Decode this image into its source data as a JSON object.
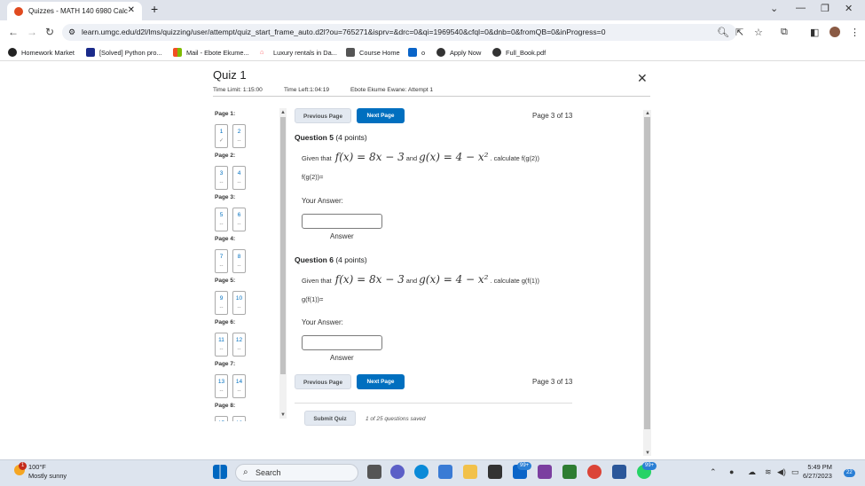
{
  "browser": {
    "tab_title": "Quizzes - MATH 140 6980 Calc",
    "new_tab": "+",
    "url": "learn.umgc.edu/d2l/lms/quizzing/user/attempt/quiz_start_frame_auto.d2l?ou=765271&isprv=&drc=0&qi=1969540&cfql=0&dnb=0&fromQB=0&inProgress=0",
    "bookmarks": [
      "Homework Market",
      "[Solved] Python pro...",
      "Mail - Ebote Ekume...",
      "Luxury rentals in Da...",
      "Course Home",
      "o",
      "Apply Now",
      "Full_Book.pdf"
    ]
  },
  "quiz": {
    "title": "Quiz 1",
    "time_limit": "Time Limit: 1:15:00",
    "time_left": "Time Left:1:04:19",
    "attempt": "Ebote Ekume Ewane: Attempt 1",
    "previous_page": "Previous Page",
    "next_page": "Next Page",
    "page_indicator": "Page 3 of 13",
    "submit": "Submit Quiz",
    "saved_status": "1 of 25 questions saved"
  },
  "sidebar": {
    "pages": [
      {
        "label": "Page 1:",
        "q": [
          {
            "n": "1",
            "s": "✓"
          },
          {
            "n": "2",
            "s": "--"
          }
        ]
      },
      {
        "label": "Page 2:",
        "q": [
          {
            "n": "3",
            "s": "--"
          },
          {
            "n": "4",
            "s": "--"
          }
        ]
      },
      {
        "label": "Page 3:",
        "q": [
          {
            "n": "5",
            "s": "--"
          },
          {
            "n": "6",
            "s": "--"
          }
        ]
      },
      {
        "label": "Page 4:",
        "q": [
          {
            "n": "7",
            "s": "--"
          },
          {
            "n": "8",
            "s": "--"
          }
        ]
      },
      {
        "label": "Page 5:",
        "q": [
          {
            "n": "9",
            "s": "--"
          },
          {
            "n": "10",
            "s": "--"
          }
        ]
      },
      {
        "label": "Page 6:",
        "q": [
          {
            "n": "11",
            "s": "--"
          },
          {
            "n": "12",
            "s": "--"
          }
        ]
      },
      {
        "label": "Page 7:",
        "q": [
          {
            "n": "13",
            "s": "--"
          },
          {
            "n": "14",
            "s": "--"
          }
        ]
      },
      {
        "label": "Page 8:",
        "q": [
          {
            "n": "15",
            "s": "--"
          },
          {
            "n": "16",
            "s": "--"
          }
        ]
      }
    ]
  },
  "questions": [
    {
      "title": "Question 5",
      "points": "(4 points)",
      "given": "Given that",
      "f": "f(x) = 8x − 3",
      "and": "and",
      "g": "g(x) = 4 − x²",
      "calc": ". calculate f(g(2))",
      "expr": "f(g(2))=",
      "your_answer": "Your Answer:",
      "answer_label": "Answer",
      "value": ""
    },
    {
      "title": "Question 6",
      "points": "(4 points)",
      "given": "Given that",
      "f": "f(x) = 8x − 3",
      "and": "and",
      "g": "g(x) = 4 − x²",
      "calc": ". calculate g(f(1))",
      "expr": "g(f(1))=",
      "your_answer": "Your Answer:",
      "answer_label": "Answer",
      "value": ""
    }
  ],
  "taskbar": {
    "weather_temp": "100°F",
    "weather_desc": "Mostly sunny",
    "weather_badge": "1",
    "search": "Search",
    "badge_a": "99+",
    "badge_b": "99+",
    "time": "5:49 PM",
    "date": "6/27/2023",
    "notif": "22"
  }
}
